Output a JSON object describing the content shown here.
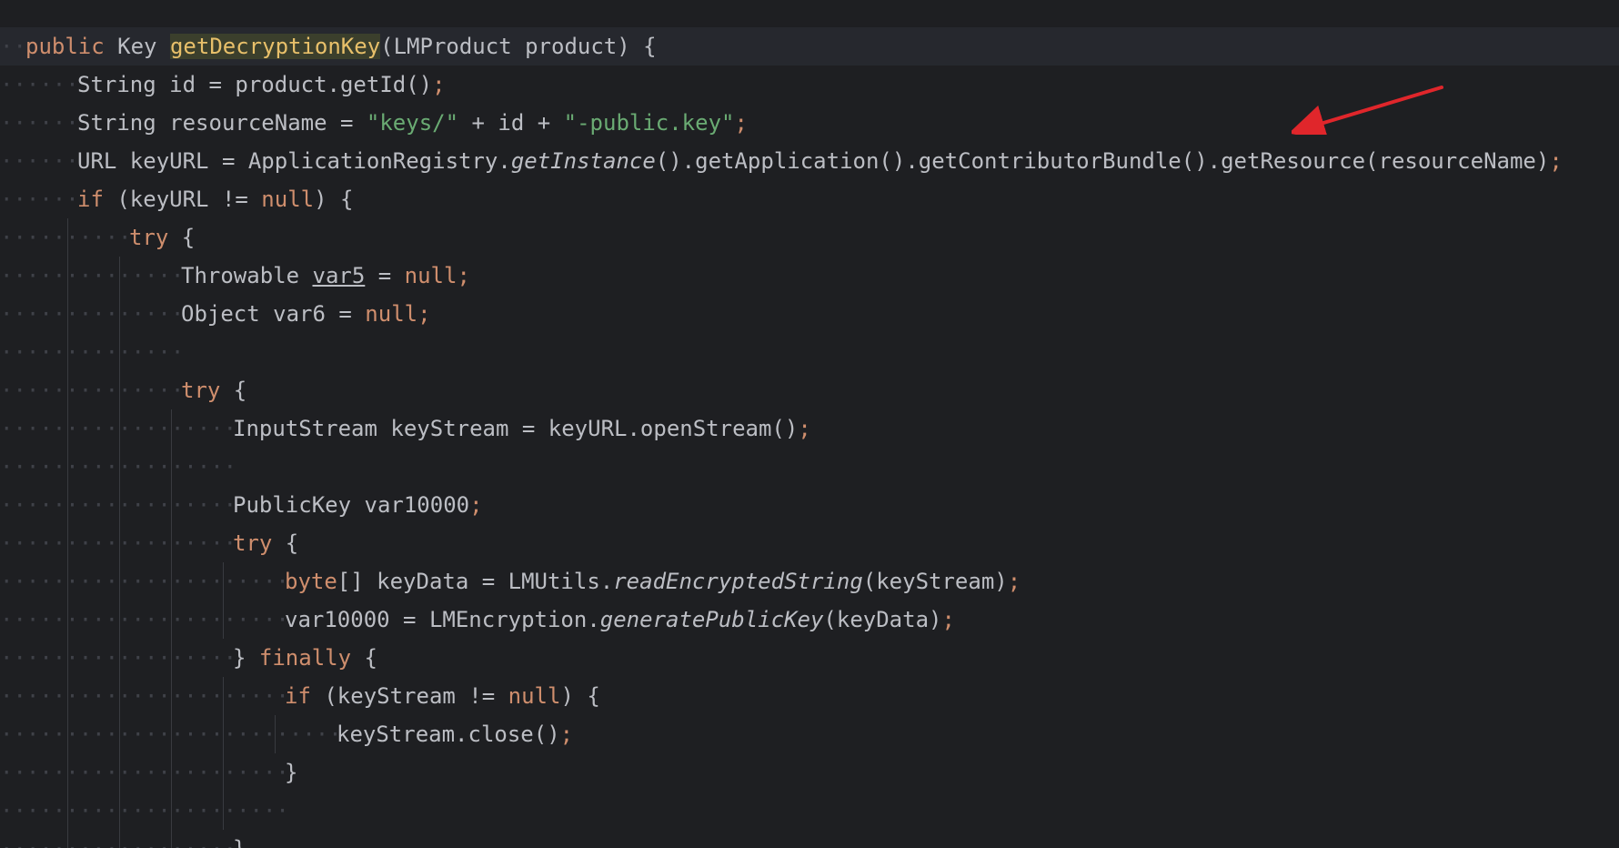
{
  "editor": {
    "lines": [
      {
        "indent": 0,
        "tokens": [
          {
            "t": "public",
            "c": "kw"
          },
          {
            "t": " "
          },
          {
            "t": "Key"
          },
          {
            "t": " "
          },
          {
            "t": "getDecryptionKey",
            "c": "decl-hl"
          },
          {
            "t": "(LMProduct product) {"
          }
        ]
      },
      {
        "indent": 1,
        "tokens": [
          {
            "t": "String id = product.getId()"
          },
          {
            "t": ";",
            "c": "kw"
          }
        ]
      },
      {
        "indent": 1,
        "tokens": [
          {
            "t": "String resourceName = "
          },
          {
            "t": "\"keys/\"",
            "c": "str"
          },
          {
            "t": " + id + "
          },
          {
            "t": "\"-public.key\"",
            "c": "str"
          },
          {
            "t": ";",
            "c": "kw"
          }
        ]
      },
      {
        "indent": 1,
        "tokens": [
          {
            "t": "URL keyURL = ApplicationRegistry."
          },
          {
            "t": "getInstance",
            "c": "ital"
          },
          {
            "t": "().getApplication().getContributorBundle().getResource(resourceName)"
          },
          {
            "t": ";",
            "c": "kw"
          }
        ]
      },
      {
        "indent": 1,
        "tokens": [
          {
            "t": "if",
            "c": "kw"
          },
          {
            "t": " (keyURL != "
          },
          {
            "t": "null",
            "c": "kw"
          },
          {
            "t": ") {"
          }
        ]
      },
      {
        "indent": 2,
        "tokens": [
          {
            "t": "try",
            "c": "kw"
          },
          {
            "t": " {"
          }
        ]
      },
      {
        "indent": 3,
        "tokens": [
          {
            "t": "Throwable "
          },
          {
            "t": "var5",
            "c": "underline"
          },
          {
            "t": " = "
          },
          {
            "t": "null;",
            "c": "kw"
          }
        ]
      },
      {
        "indent": 3,
        "tokens": [
          {
            "t": "Object var6 = "
          },
          {
            "t": "null;",
            "c": "kw"
          }
        ]
      },
      {
        "indent": 3,
        "tokens": []
      },
      {
        "indent": 3,
        "tokens": [
          {
            "t": "try",
            "c": "kw"
          },
          {
            "t": " {"
          }
        ]
      },
      {
        "indent": 4,
        "tokens": [
          {
            "t": "InputStream keyStream = keyURL.openStream()"
          },
          {
            "t": ";",
            "c": "kw"
          }
        ]
      },
      {
        "indent": 4,
        "tokens": []
      },
      {
        "indent": 4,
        "tokens": [
          {
            "t": "PublicKey var10000"
          },
          {
            "t": ";",
            "c": "kw"
          }
        ]
      },
      {
        "indent": 4,
        "tokens": [
          {
            "t": "try",
            "c": "kw"
          },
          {
            "t": " {"
          }
        ]
      },
      {
        "indent": 5,
        "tokens": [
          {
            "t": "byte",
            "c": "kw"
          },
          {
            "t": "[] keyData = LMUtils."
          },
          {
            "t": "readEncryptedString",
            "c": "ital"
          },
          {
            "t": "(keyStream)"
          },
          {
            "t": ";",
            "c": "kw"
          }
        ]
      },
      {
        "indent": 5,
        "tokens": [
          {
            "t": "var10000 = LMEncryption."
          },
          {
            "t": "generatePublicKey",
            "c": "ital"
          },
          {
            "t": "(keyData)"
          },
          {
            "t": ";",
            "c": "kw"
          }
        ]
      },
      {
        "indent": 4,
        "tokens": [
          {
            "t": "} "
          },
          {
            "t": "finally",
            "c": "kw"
          },
          {
            "t": " {"
          }
        ]
      },
      {
        "indent": 5,
        "tokens": [
          {
            "t": "if",
            "c": "kw"
          },
          {
            "t": " (keyStream != "
          },
          {
            "t": "null",
            "c": "kw"
          },
          {
            "t": ") {"
          }
        ]
      },
      {
        "indent": 6,
        "tokens": [
          {
            "t": "keyStream.close()"
          },
          {
            "t": ";",
            "c": "kw"
          }
        ]
      },
      {
        "indent": 5,
        "tokens": [
          {
            "t": "}"
          }
        ]
      },
      {
        "indent": 5,
        "tokens": []
      },
      {
        "indent": 4,
        "tokens": [
          {
            "t": "}"
          }
        ]
      }
    ]
  },
  "annotation": {
    "arrow_color": "#e0262b"
  },
  "colors": {
    "background": "#1e1f22",
    "text": "#bcbec4",
    "keyword": "#cf8e6d",
    "string": "#6aab73",
    "declaration_highlight": "#e8c06a"
  }
}
